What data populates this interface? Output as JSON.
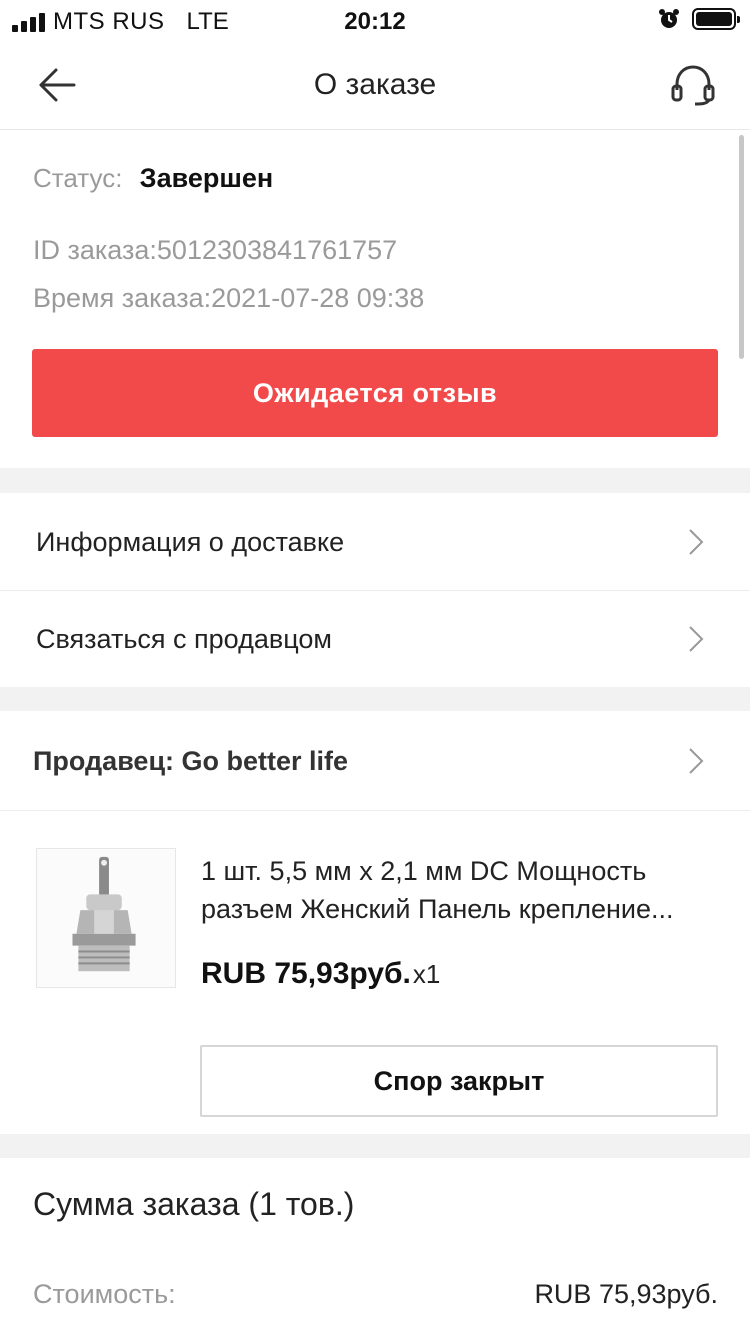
{
  "status_bar": {
    "carrier": "MTS RUS",
    "network": "LTE",
    "time": "20:12",
    "icons": [
      "signal-icon",
      "alarm-icon",
      "battery-icon"
    ]
  },
  "header": {
    "title": "О заказе",
    "back_icon": "arrow-left-icon",
    "support_icon": "headset-icon"
  },
  "order": {
    "status_label": "Статус:",
    "status_value": "Завершен",
    "id_line": "ID заказа:5012303841761757",
    "time_line": "Время заказа:2021-07-28 09:38",
    "review_button": "Ожидается отзыв"
  },
  "links": {
    "delivery": "Информация о доставке",
    "contact_seller": "Связаться с продавцом"
  },
  "seller": {
    "label": "Продавец: Go better life"
  },
  "product": {
    "title_line1": "1 шт. 5,5 мм x 2,1 мм DC Мощность",
    "title_line2": "разъем Женский Панель крепление...",
    "price": "RUB 75,93руб.",
    "quantity": "x1",
    "dispute_button": "Спор закрыт"
  },
  "summary": {
    "title": "Сумма заказа (1 тов.)",
    "cost_label": "Стоимость:",
    "cost_value": "RUB 75,93руб."
  },
  "colors": {
    "accent_red": "#f24a4a",
    "muted_text": "#9a9a9a",
    "separator": "#f2f2f2"
  }
}
